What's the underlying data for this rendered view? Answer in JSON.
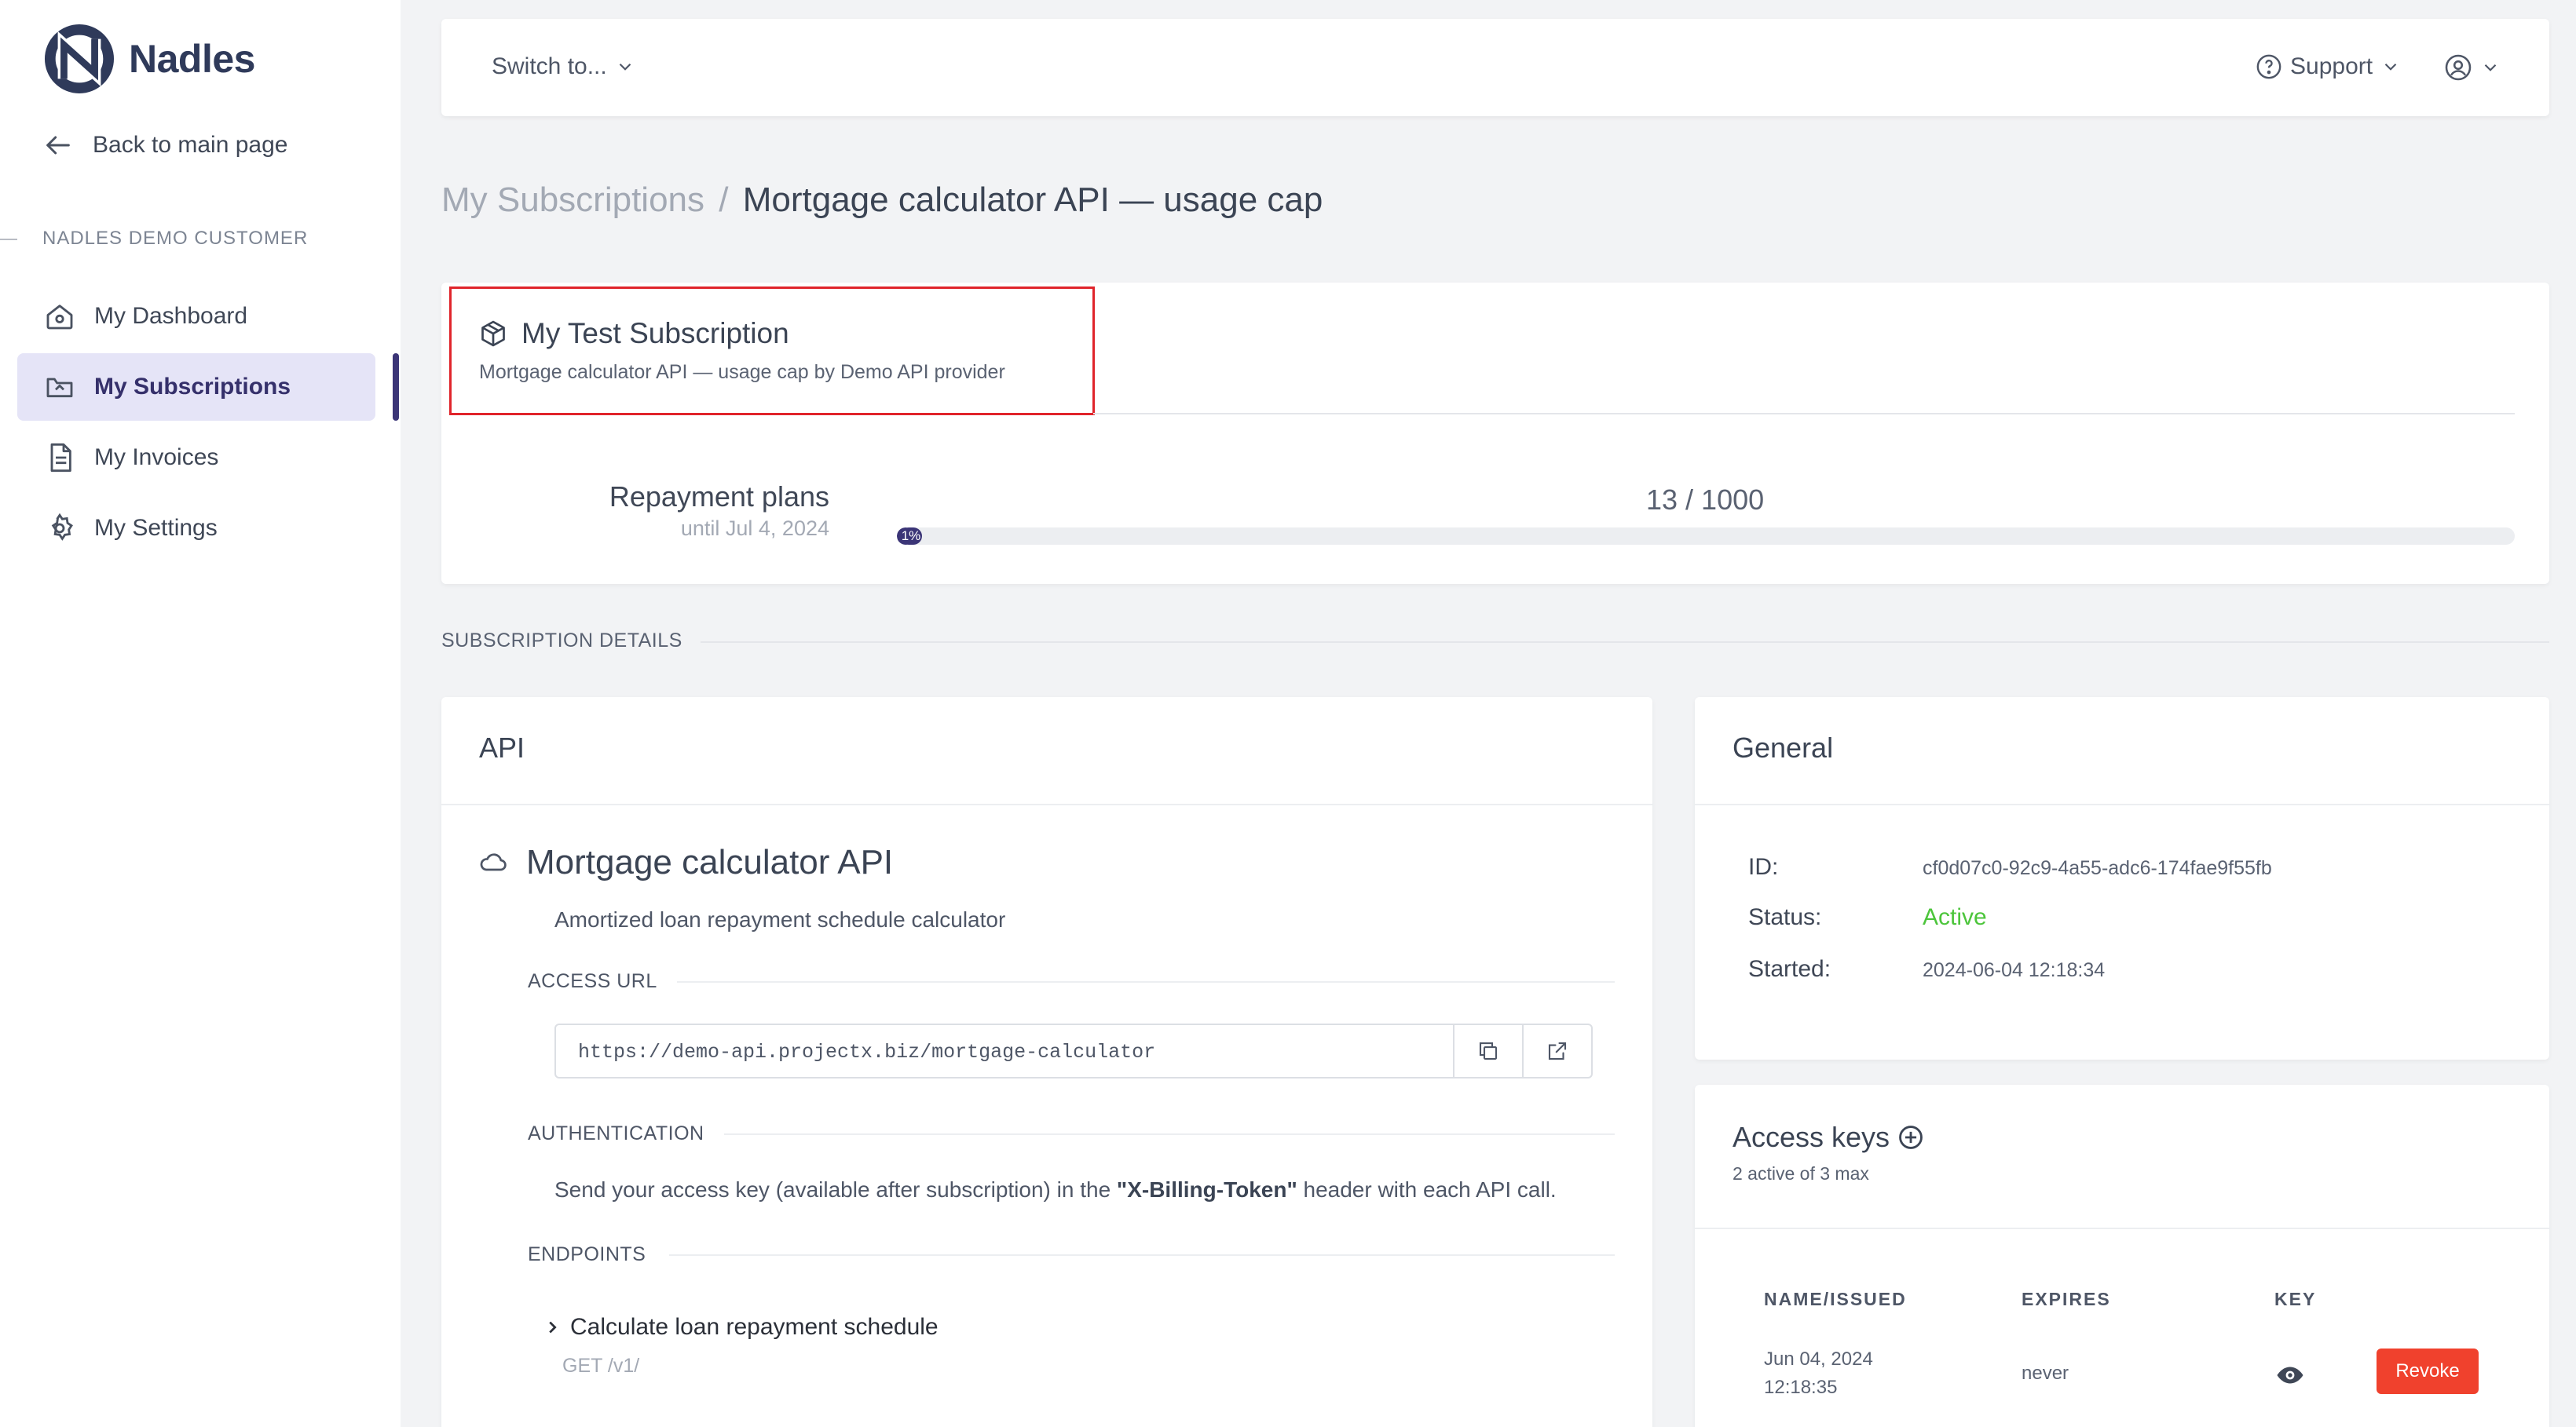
{
  "brand": {
    "name": "Nadles",
    "accent": "#3b3577"
  },
  "sidebar": {
    "back_label": "Back to main page",
    "section_label": "NADLES DEMO CUSTOMER",
    "items": [
      {
        "label": "My Dashboard",
        "icon": "home-icon"
      },
      {
        "label": "My Subscriptions",
        "icon": "subscriptions-icon",
        "active": true
      },
      {
        "label": "My Invoices",
        "icon": "invoice-icon"
      },
      {
        "label": "My Settings",
        "icon": "gear-icon"
      }
    ]
  },
  "topbar": {
    "switch_label": "Switch to...",
    "support_label": "Support"
  },
  "breadcrumb": {
    "parent": "My Subscriptions",
    "separator": "/",
    "current": "Mortgage calculator API — usage cap"
  },
  "subscription": {
    "title": "My Test Subscription",
    "subtitle": "Mortgage calculator API — usage cap by Demo API provider",
    "usage": {
      "label": "Repayment plans",
      "until": "until Jul 4, 2024",
      "count": "13 / 1000",
      "percent": 1,
      "percent_label": "1%"
    }
  },
  "details_label": "SUBSCRIPTION DETAILS",
  "api_card": {
    "heading": "API",
    "name": "Mortgage calculator API",
    "description": "Amortized loan repayment schedule calculator",
    "access_url_label": "ACCESS URL",
    "access_url": "https://demo-api.projectx.biz/mortgage-calculator",
    "auth_label": "AUTHENTICATION",
    "auth_prefix": "Send your access key (available after subscription) in the ",
    "auth_header": "\"X-Billing-Token\"",
    "auth_suffix": " header with each API call.",
    "endpoints_label": "ENDPOINTS",
    "endpoints": [
      {
        "name": "Calculate loan repayment schedule",
        "method_path": "GET /v1/"
      }
    ]
  },
  "general": {
    "heading": "General",
    "id_label": "ID:",
    "id_value": "cf0d07c0-92c9-4a55-adc6-174fae9f55fb",
    "status_label": "Status:",
    "status_value": "Active",
    "status_color": "#4cc53b",
    "started_label": "Started:",
    "started_value": "2024-06-04 12:18:34"
  },
  "access_keys": {
    "heading": "Access keys",
    "subheading": "2 active of 3 max",
    "columns": [
      "NAME/ISSUED",
      "EXPIRES",
      "KEY"
    ],
    "rows": [
      {
        "issued_date": "Jun 04, 2024",
        "issued_time": "12:18:35",
        "expires": "never",
        "action": "Revoke"
      }
    ]
  }
}
